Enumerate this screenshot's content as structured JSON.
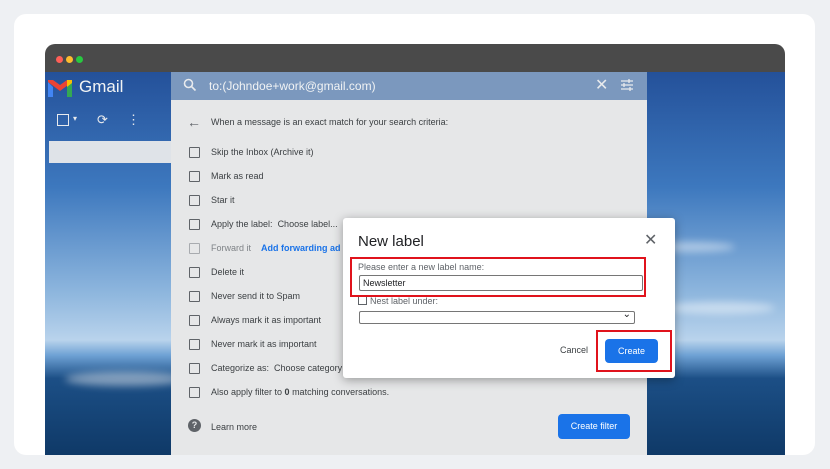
{
  "app": {
    "name": "Gmail"
  },
  "search": {
    "query": "to:(Johndoe+work@gmail.com)"
  },
  "filter_panel": {
    "criteria_heading": "When a message is an exact match for your search criteria:",
    "options": [
      {
        "label": "Skip the Inbox (Archive it)"
      },
      {
        "label": "Mark as read"
      },
      {
        "label": "Star it"
      },
      {
        "label": "Apply the label:",
        "extra": "Choose label..."
      },
      {
        "label": "Forward it",
        "link": "Add forwarding ad",
        "disabled": true
      },
      {
        "label": "Delete it"
      },
      {
        "label": "Never send it to Spam"
      },
      {
        "label": "Always mark it as important"
      },
      {
        "label": "Never mark it as important"
      },
      {
        "label": "Categorize as:",
        "extra": "Choose category"
      },
      {
        "label_pre": "Also apply filter to ",
        "count": "0",
        "label_post": " matching conversations."
      }
    ],
    "learn_more": "Learn more",
    "create_filter_button": "Create filter"
  },
  "dialog": {
    "title": "New label",
    "prompt": "Please enter a new label name:",
    "label_name_value": "Newsletter",
    "nest_label": "Nest label under:",
    "cancel_button": "Cancel",
    "create_button": "Create"
  },
  "colors": {
    "accent": "#1a73e8",
    "highlight": "#e0131c"
  },
  "icons": [
    "gmail-logo",
    "search-icon",
    "close-icon",
    "tune-icon",
    "checkbox-icon",
    "refresh-icon",
    "more-icon",
    "back-arrow-icon",
    "help-icon"
  ]
}
